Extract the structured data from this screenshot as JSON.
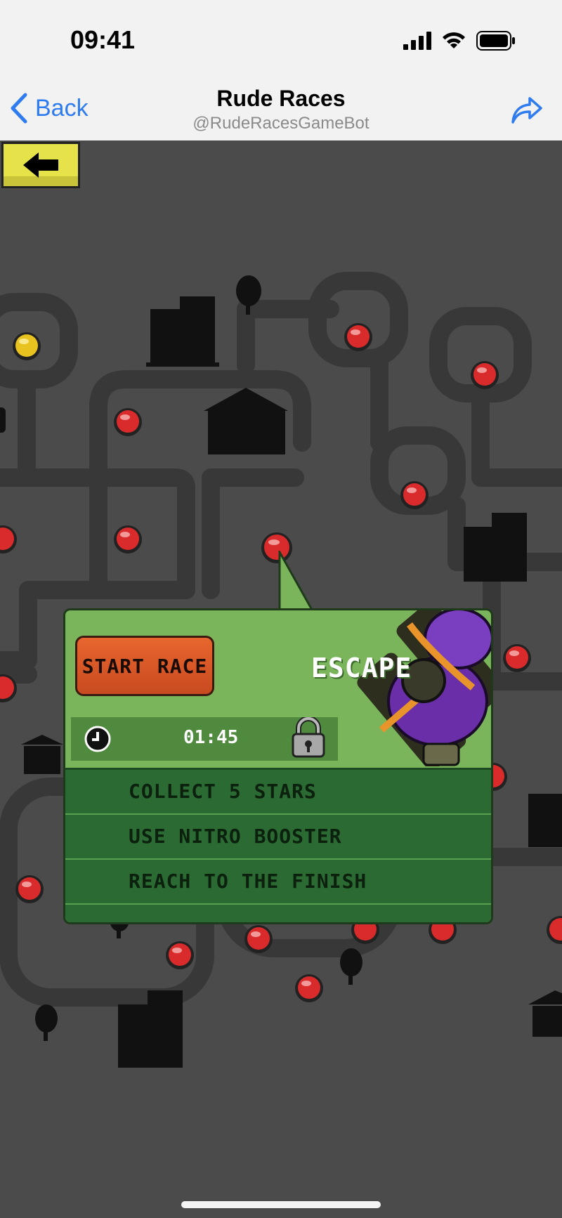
{
  "status_bar": {
    "time": "09:41",
    "icons": [
      "signal-icon",
      "wifi-icon",
      "battery-icon"
    ]
  },
  "nav": {
    "back_label": "Back",
    "title": "Rude Races",
    "subtitle": "@RudeRacesGameBot",
    "share_icon": "share-icon"
  },
  "game": {
    "back_button_icon": "arrow-left-icon",
    "popup": {
      "start_label": "START RACE",
      "level_name": "ESCAPE",
      "time": "01:45",
      "locked": true,
      "objectives": [
        "COLLECT 5 STARS",
        "USE NITRO BOOSTER",
        "REACH TO THE FINISH"
      ]
    },
    "colors": {
      "map_bg": "#4b4b4b",
      "road": "#383838",
      "node_red": "#d92b2b",
      "node_current": "#e8c21e",
      "popup_green": "#7ab55c",
      "objectives_green": "#2b6a33",
      "start_button": "#e05a28",
      "back_button": "#e6e34a"
    }
  }
}
